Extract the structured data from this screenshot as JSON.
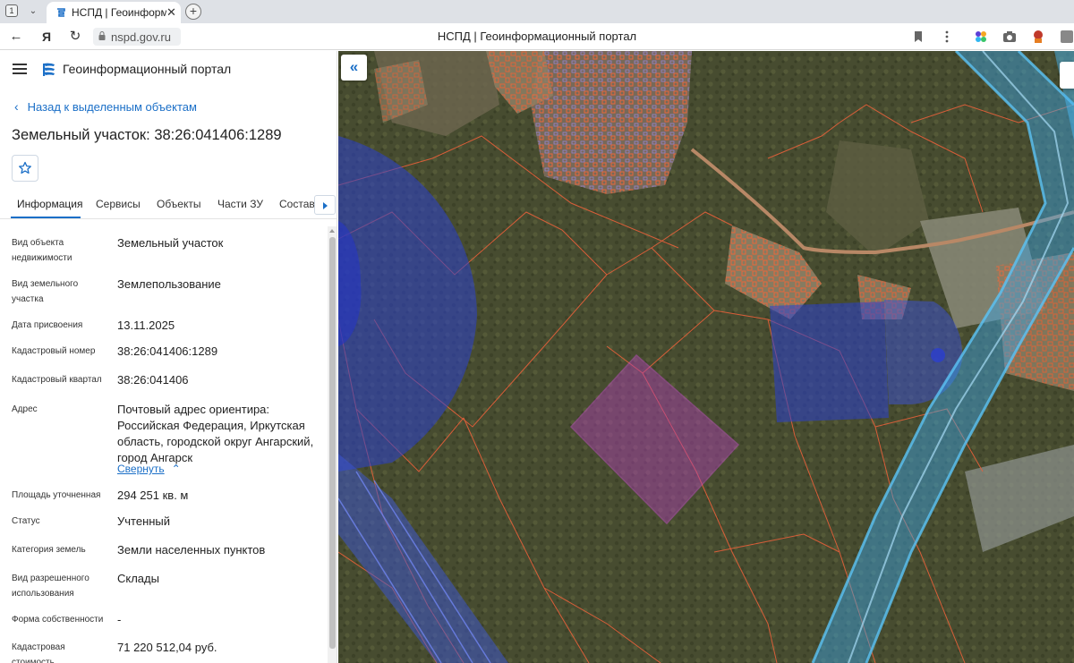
{
  "browser": {
    "tab_counter": "1",
    "tab_title": "НСПД | Геоинформационный портал",
    "url": "nspd.gov.ru",
    "window_title": "НСПД | Геоинформационный портал"
  },
  "panel": {
    "portal_name": "Геоинформационный портал",
    "back_label": "Назад к выделенным объектам",
    "object_title": "Земельный участок: 38:26:041406:1289",
    "tabs": [
      "Информация",
      "Сервисы",
      "Объекты",
      "Части ЗУ",
      "Состав"
    ],
    "active_tab": "Информация",
    "properties": [
      {
        "label": "Вид объекта недвижимости",
        "value": "Земельный участок"
      },
      {
        "label": "Вид земельного участка",
        "value": "Землепользование"
      },
      {
        "label": "Дата присвоения",
        "value": "13.11.2025"
      },
      {
        "label": "Кадастровый номер",
        "value": "38:26:041406:1289"
      },
      {
        "label": "Кадастровый квартал",
        "value": "38:26:041406"
      },
      {
        "label": "Адрес",
        "value": "Почтовый адрес ориентира: Российская Федерация, Иркутская область, городской округ Ангарский, город Ангарск"
      },
      {
        "label": "Площадь уточненная",
        "value": "294 251 кв. м"
      },
      {
        "label": "Статус",
        "value": "Учтенный"
      },
      {
        "label": "Категория земель",
        "value": "Земли населенных пунктов"
      },
      {
        "label": "Вид разрешенного использования",
        "value": "Склады"
      },
      {
        "label": "Форма собственности",
        "value": "-"
      },
      {
        "label": "Кадастровая стоимость",
        "value": "71 220 512,04 руб."
      }
    ],
    "collapse_label": "Свернуть"
  },
  "map": {
    "collapse_button": "«"
  },
  "colors": {
    "accent": "#1b6fc7",
    "parcel_border": "#e8603a",
    "selected_parcel": "#b23fb8",
    "zone_blue": "#2a3fd0",
    "zone_cyan": "#3aa6e8"
  }
}
